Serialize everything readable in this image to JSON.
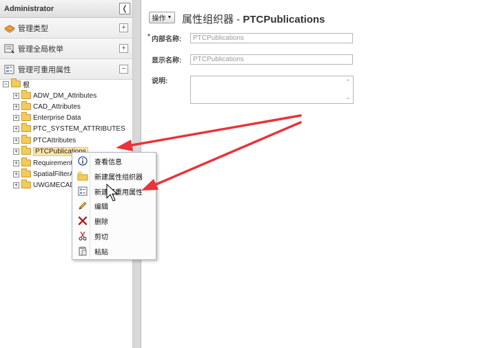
{
  "sidebar": {
    "title": "Administrator",
    "collapse_icon": "chevron-left-icon",
    "sections": [
      {
        "label": "管理类型",
        "icon": "types-icon",
        "toggle": "+"
      },
      {
        "label": "管理全局枚举",
        "icon": "enum-icon",
        "toggle": "+"
      },
      {
        "label": "管理可重用属性",
        "icon": "attributes-icon",
        "toggle": "−"
      }
    ]
  },
  "tree": {
    "root": "根",
    "items": [
      "ADW_DM_Attributes",
      "CAD_Attributes",
      "Enterprise Data",
      "PTC_SYSTEM_ATTRIBUTES",
      "PTCAttributes",
      "PTCPublications",
      "Requirement",
      "SpatialFilterA",
      "UWGMECAD_"
    ],
    "selected": "PTCPublications"
  },
  "header": {
    "ops_label": "操作",
    "title_prefix": "属性组织器 - ",
    "title_name": "PTCPublications"
  },
  "form": {
    "internal_name_label": "内部名称:",
    "internal_name_value": "PTCPublications",
    "required_mark": "*",
    "display_name_label": "显示名称:",
    "display_name_value": "PTCPublications",
    "description_label": "说明:"
  },
  "context_menu": {
    "items": [
      {
        "label": "查看信息",
        "icon": "info-icon"
      },
      {
        "label": "新建属性组织器",
        "icon": "new-folder-icon"
      },
      {
        "label": "新建可重用属性",
        "icon": "new-attribute-icon"
      },
      {
        "label": "编辑",
        "icon": "pencil-icon"
      },
      {
        "label": "删除",
        "icon": "delete-icon"
      },
      {
        "label": "剪切",
        "icon": "scissors-icon"
      },
      {
        "label": "粘贴",
        "icon": "paste-icon"
      }
    ]
  },
  "colors": {
    "arrow": "#e8343a",
    "folder": "#f3cb58",
    "selection": "#ffe6a8"
  }
}
